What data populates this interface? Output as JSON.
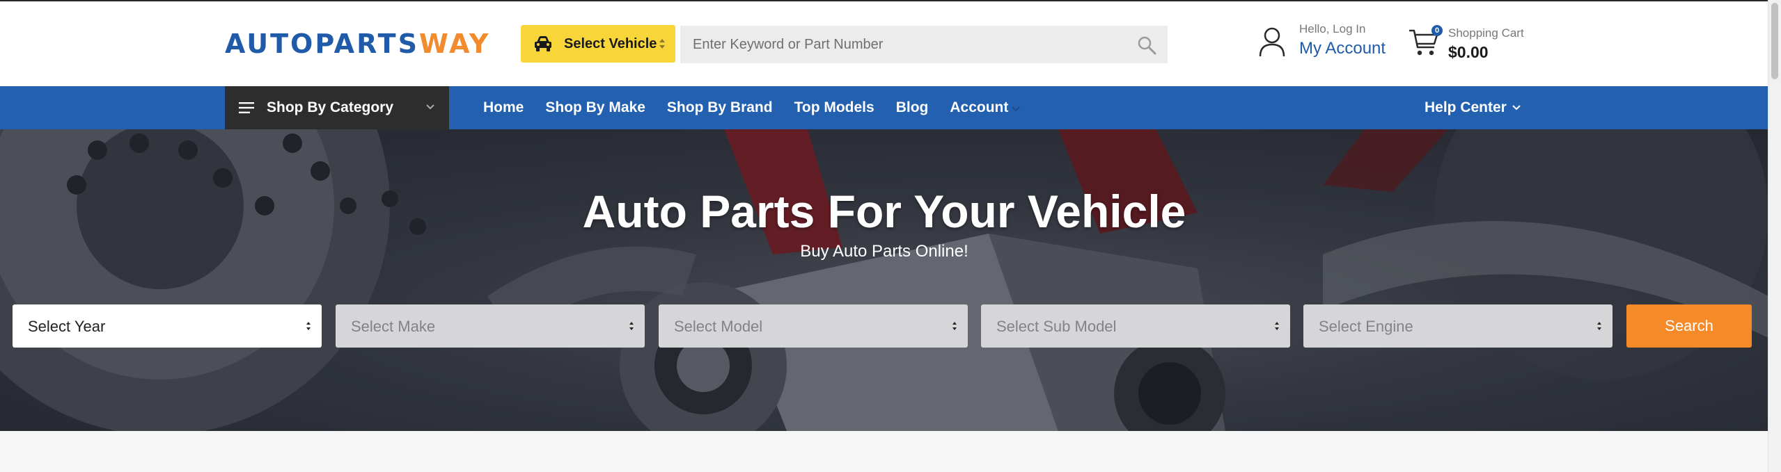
{
  "header": {
    "logo": {
      "part1": "AUTOPARTS",
      "part2": "WAY"
    },
    "select_vehicle": {
      "label": "Select Vehicle"
    },
    "search": {
      "placeholder": "Enter Keyword or Part Number"
    },
    "account": {
      "greeting": "Hello, Log In",
      "label": "My Account"
    },
    "cart": {
      "title": "Shopping Cart",
      "total": "$0.00",
      "count": "0"
    }
  },
  "nav": {
    "category_button": "Shop By Category",
    "links": [
      "Home",
      "Shop By Make",
      "Shop By Brand",
      "Top Models",
      "Blog",
      "Account"
    ],
    "help": "Help Center"
  },
  "hero": {
    "title": "Auto Parts For Your Vehicle",
    "subtitle": "Buy Auto Parts Online!",
    "selects": {
      "year": "Select Year",
      "make": "Select Make",
      "model": "Select Model",
      "sub_model": "Select Sub Model",
      "engine": "Select Engine"
    },
    "search_button": "Search"
  },
  "colors": {
    "brand_blue": "#2360b0",
    "brand_orange": "#f58a28",
    "vehicle_yellow": "#f8d63a",
    "category_dark": "#2d2d2d"
  }
}
